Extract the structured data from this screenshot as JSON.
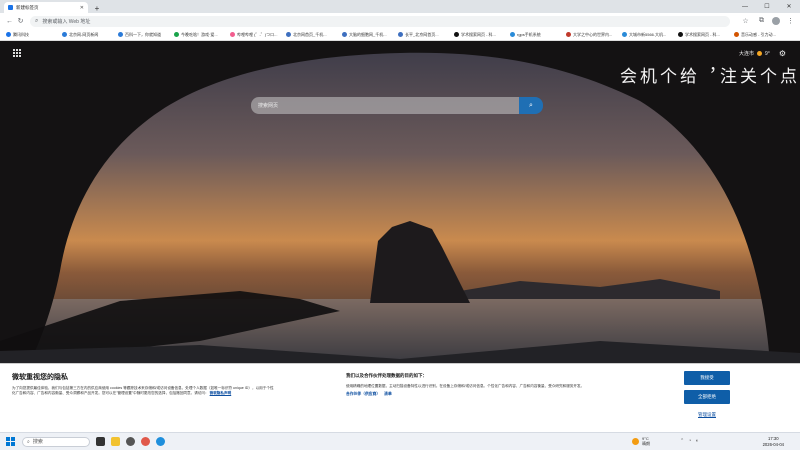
{
  "browser": {
    "tab_title": "新建标签页",
    "omnibox_placeholder": "搜索或输入 Web 地址"
  },
  "bookmarks": [
    {
      "label": "腾讯科技",
      "color": "#1a73e8"
    },
    {
      "label": "北京网-网页新闻",
      "color": "#2b7bd8"
    },
    {
      "label": "百科一下，你就知道",
      "color": "#2b7bd8"
    },
    {
      "label": "今晚吃啥！游戏·爱...",
      "color": "#19a34a"
    },
    {
      "label": "哔哩哔哩 (゜-゜)つロ...",
      "color": "#f25d8e"
    },
    {
      "label": "北京网首页_千机...",
      "color": "#3e6fbf"
    },
    {
      "label": "大脑的细胞网_千机...",
      "color": "#3e6fbf"
    },
    {
      "label": "长平_北京网首页...",
      "color": "#3e6fbf"
    },
    {
      "label": "学术搜索网页 - 科...",
      "color": "#111111"
    },
    {
      "label": "rgps手机系统",
      "color": "#2a8bd8"
    },
    {
      "label": "大学之中心的世界内...",
      "color": "#c0392b"
    },
    {
      "label": "大城市新5566.大机...",
      "color": "#2a8bd8"
    },
    {
      "label": "学术搜索网页 - 科...",
      "color": "#111111"
    },
    {
      "label": "音乐动感 - 引力动...",
      "color": "#d35400"
    }
  ],
  "newtab": {
    "location": "大连市",
    "temperature": "9°",
    "search_placeholder": "搜索网页",
    "vertical_text": [
      "点",
      "个",
      "关",
      "注",
      "，",
      "给",
      "个",
      "机",
      "会"
    ]
  },
  "privacy": {
    "title": "微软重视您的隐私",
    "body": "为了向您提供最佳体验，我们与包括第三方在内的供应商使用 cookies 等跟踪技术来存储和/或访问设备信息，处理个人数据（如唯一标识符 unique ID），以用于个性化广告和内容、广告和内容衡量、受众洞察和产品开发。您可以在\"管理设置\"中随时更改您的选择，包括撤回同意。请访问：",
    "privacy_link": "微软隐私声明",
    "mid_title": "我们以及合作伙伴处理数据的目的如下：",
    "mid_body": "使用精确的地理位置数据，主动扫描设备特性以进行识别。在设备上存储和/或访问信息。个性化广告和内容、广告和内容衡量、受众研究和服务开发。",
    "vendors_label": "合作伙伴（供应商）",
    "vendors_list": "清单",
    "accept_label": "我接受",
    "reject_label": "全部拒绝",
    "manage_label": "管理设置"
  },
  "taskbar": {
    "search_label": "搜索",
    "weather_temp": "9°C",
    "weather_desc": "晴朗",
    "time": "17:30",
    "date": "2026-04-04"
  }
}
